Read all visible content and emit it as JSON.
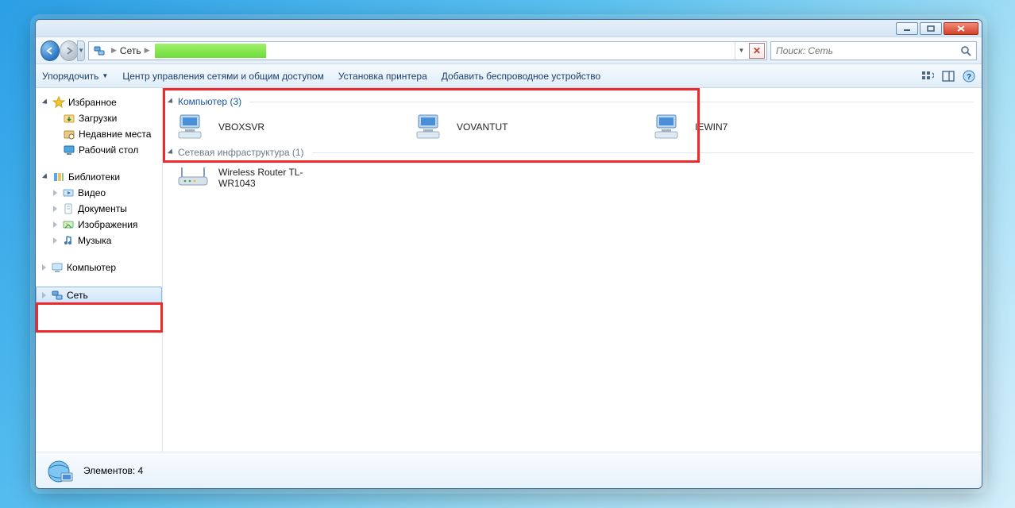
{
  "address": {
    "location_label": "Сеть"
  },
  "search": {
    "placeholder": "Поиск: Сеть"
  },
  "toolbar": {
    "organize": "Упорядочить",
    "network_center": "Центр управления сетями и общим доступом",
    "add_printer": "Установка принтера",
    "add_wireless": "Добавить беспроводное устройство"
  },
  "navpane": {
    "favorites": "Избранное",
    "favorites_items": {
      "downloads": "Загрузки",
      "recent": "Недавние места",
      "desktop": "Рабочий стол"
    },
    "libraries": "Библиотеки",
    "libraries_items": {
      "video": "Видео",
      "documents": "Документы",
      "images": "Изображения",
      "music": "Музыка"
    },
    "computer": "Компьютер",
    "network": "Сеть"
  },
  "groups": {
    "computers": {
      "title": "Компьютер",
      "count": "(3)",
      "items": [
        "VBOXSVR",
        "VOVANTUT",
        "IEWIN7"
      ]
    },
    "infrastructure": {
      "title": "Сетевая инфраструктура",
      "count": "(1)",
      "items": [
        "Wireless Router TL-WR1043"
      ]
    }
  },
  "status": {
    "elements_label": "Элементов: 4"
  }
}
